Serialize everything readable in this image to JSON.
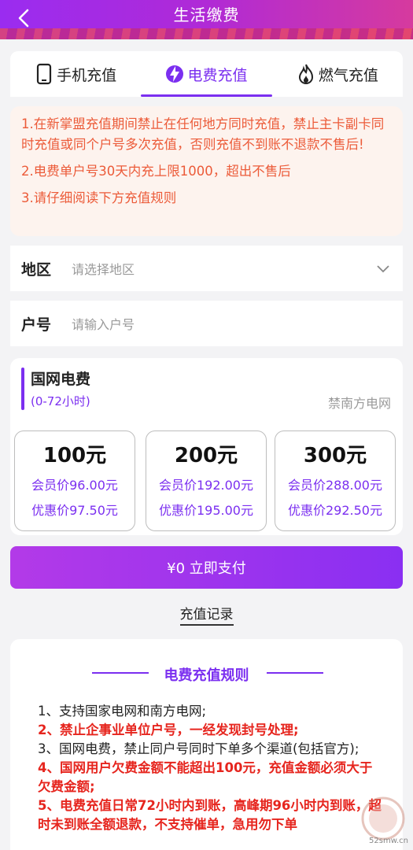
{
  "header": {
    "title": "生活缴费"
  },
  "tabs": [
    {
      "label": "手机充值",
      "icon": "phone-icon"
    },
    {
      "label": "电费充值",
      "icon": "lightning-icon"
    },
    {
      "label": "燃气充值",
      "icon": "flame-icon"
    }
  ],
  "notice": [
    "1.在新掌盟充值期间禁止在任何地方同时充值，禁止主卡副卡同时充值或同个户号多次充值，否则充值不到账不退款不售后!",
    "2.电费单户号30天内充上限1000，超出不售后",
    "3.请仔细阅读下方充值规则"
  ],
  "region": {
    "label": "地区",
    "placeholder": "请选择地区"
  },
  "account": {
    "label": "户号",
    "placeholder": "请输入户号"
  },
  "provider": {
    "name": "国网电费",
    "time": "(0-72小时)",
    "grid": "禁南方电网"
  },
  "options": [
    {
      "amount": "100元",
      "member": "会员价96.00元",
      "discount": "优惠价97.50元"
    },
    {
      "amount": "200元",
      "member": "会员价192.00元",
      "discount": "优惠价195.00元"
    },
    {
      "amount": "300元",
      "member": "会员价288.00元",
      "discount": "优惠价292.50元"
    }
  ],
  "pay": {
    "label": "¥0 立即支付"
  },
  "record": {
    "label": "充值记录"
  },
  "rules": {
    "title": "电费充值规则",
    "items": [
      "1、支持国家电网和南方电网;",
      "2、禁止企事业单位户号，一经发现封号处理;",
      "3、国网电费，禁止同户号同时下单多个渠道(包括官方);",
      "4、国网用户欠费金额不能超出100元，充值金额必须大于欠费金额;",
      "5、电费充值日常72小时内到账，高峰期96小时内到账，超时未到账全额退款，不支持催单，急用勿下单"
    ]
  },
  "watermark": {
    "text": "52smw.cn"
  },
  "colors": {
    "accent": "#7b2ff0",
    "notice": "#ec5b39",
    "rule_red": "#e6251e"
  }
}
